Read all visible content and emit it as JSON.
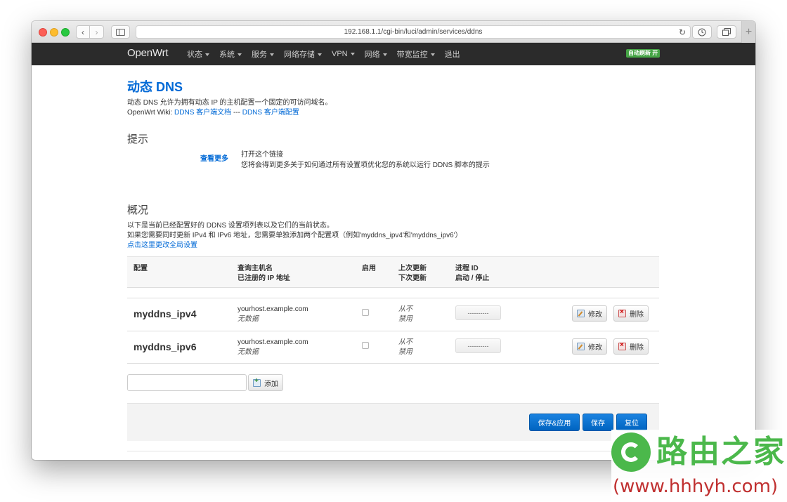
{
  "browser": {
    "url": "192.168.1.1/cgi-bin/luci/admin/services/ddns",
    "back": "‹",
    "forward": "›",
    "reload": "↻",
    "newtab": "+"
  },
  "navbar": {
    "brand": "OpenWrt",
    "menu": [
      "状态",
      "系统",
      "服务",
      "网络存储",
      "VPN",
      "网络",
      "带宽监控",
      "退出"
    ],
    "auto_refresh": "自动刷新 开"
  },
  "page": {
    "title": "动态 DNS",
    "desc_line1": "动态 DNS 允许为拥有动态 IP 的主机配置一个固定的可访问域名。",
    "wiki_prefix": "OpenWrt Wiki: ",
    "wiki_link1": "DDNS 客户端文档",
    "wiki_sep": " --- ",
    "wiki_link2": "DDNS 客户端配置"
  },
  "hints": {
    "title": "提示",
    "label": "查看更多",
    "line1": "打开这个链接",
    "line2": "您将会得到更多关于如何通过所有设置项优化您的系统以运行 DDNS 脚本的提示"
  },
  "overview": {
    "title": "概况",
    "line1": "以下是当前已经配置好的 DDNS 设置项列表以及它们的当前状态。",
    "line2": "如果您需要同时更新 IPv4 和 IPv6 地址，您需要单独添加两个配置项（例如'myddns_ipv4'和'myddns_ipv6'）",
    "global_link": "点击这里更改全局设置"
  },
  "table": {
    "headers": {
      "config": "配置",
      "host1": "查询主机名",
      "host2": "已注册的 IP 地址",
      "enabled": "启用",
      "last1": "上次更新",
      "last2": "下次更新",
      "pid1": "进程 ID",
      "pid2": "启动 / 停止"
    },
    "rows": [
      {
        "name": "myddns_ipv4",
        "host": "yourhost.example.com",
        "ip": "无数据",
        "last": "从不",
        "next": "禁用",
        "pid": "----------",
        "edit": "修改",
        "delete": "删除"
      },
      {
        "name": "myddns_ipv6",
        "host": "yourhost.example.com",
        "ip": "无数据",
        "last": "从不",
        "next": "禁用",
        "pid": "----------",
        "edit": "修改",
        "delete": "删除"
      }
    ]
  },
  "add": {
    "input_value": "",
    "button": "添加"
  },
  "actions": {
    "save_apply": "保存&应用",
    "save": "保存",
    "reset": "复位"
  },
  "watermark": {
    "title": "路由之家",
    "url": "(www.hhhyh.com)"
  }
}
